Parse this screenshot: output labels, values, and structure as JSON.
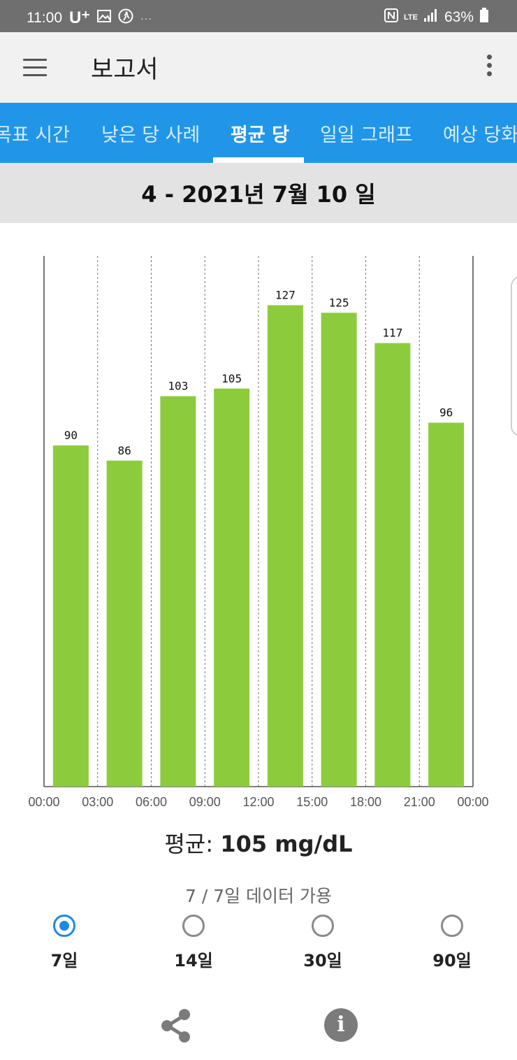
{
  "status_bar": {
    "time": "11:00",
    "carrier": "U⁺",
    "more": "···",
    "network": "LTE",
    "battery": "63%"
  },
  "app_bar": {
    "title": "보고서",
    "menu_icon": "hamburger-menu-icon",
    "more_icon": "more-vertical-icon"
  },
  "tabs": [
    {
      "label": "목표 시간",
      "active": false
    },
    {
      "label": "낮은 당 사례",
      "active": false
    },
    {
      "label": "평균 당",
      "active": true
    },
    {
      "label": "일일 그래프",
      "active": false
    },
    {
      "label": "예상 당화",
      "active": false
    }
  ],
  "date_range": "4 - 2021년 7월 10 일",
  "chart_data": {
    "type": "bar",
    "categories": [
      "00:00",
      "03:00",
      "06:00",
      "09:00",
      "12:00",
      "15:00",
      "18:00",
      "21:00"
    ],
    "values": [
      90,
      86,
      103,
      105,
      127,
      125,
      117,
      96
    ],
    "x_ticks": [
      "00:00",
      "03:00",
      "06:00",
      "09:00",
      "12:00",
      "15:00",
      "18:00",
      "21:00",
      "00:00"
    ],
    "ylim": [
      0,
      140
    ],
    "bar_color": "#8ccc3c",
    "grid": "vertical dashed"
  },
  "average": {
    "label": "평균:",
    "value": "105 mg/dL"
  },
  "availability": "7 / 7일 데이터 가용",
  "period_options": [
    {
      "label": "7일",
      "selected": true
    },
    {
      "label": "14일",
      "selected": false
    },
    {
      "label": "30일",
      "selected": false
    },
    {
      "label": "90일",
      "selected": false
    }
  ],
  "actions": {
    "share_icon": "share-icon",
    "info_icon": "info-icon",
    "info_glyph": "i"
  },
  "colors": {
    "tab_bar": "#2196e9",
    "accent_radio": "#1e88e5",
    "bar": "#8ccc3c"
  }
}
